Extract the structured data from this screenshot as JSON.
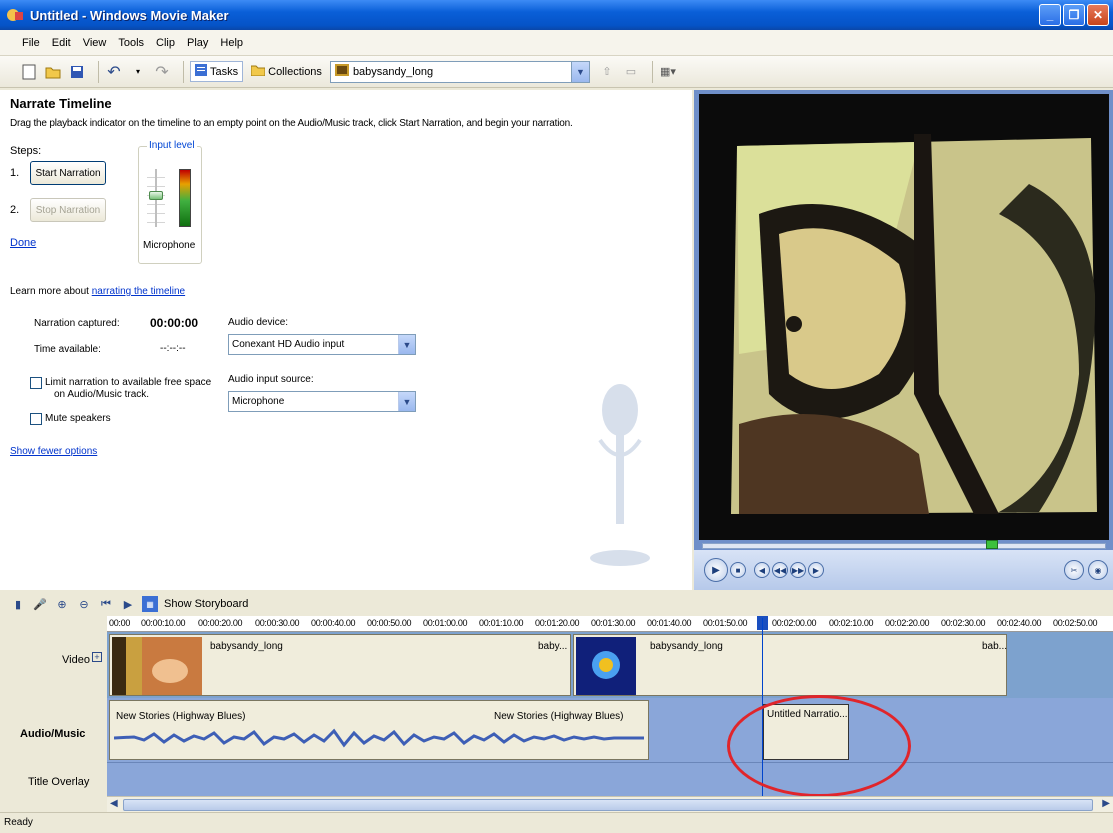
{
  "window": {
    "title": "Untitled - Windows Movie Maker"
  },
  "menu": [
    "File",
    "Edit",
    "View",
    "Tools",
    "Clip",
    "Play",
    "Help"
  ],
  "toolbar": {
    "tasks_label": "Tasks",
    "collections_label": "Collections",
    "collection_value": "babysandy_long"
  },
  "narrate": {
    "title": "Narrate Timeline",
    "instructions": "Drag the playback indicator on the timeline to an empty point on the Audio/Music track, click Start Narration, and begin your narration.",
    "steps_label": "Steps:",
    "step1_num": "1.",
    "step2_num": "2.",
    "start_label": "Start Narration",
    "stop_label": "Stop Narration",
    "done_label": "Done",
    "input_level_label": "Input level",
    "microphone_label": "Microphone",
    "input_level_value": 0.55,
    "learn_prefix": "Learn more about ",
    "learn_link": "narrating the timeline",
    "captured_label": "Narration captured:",
    "captured_value": "00:00:00",
    "available_label": "Time available:",
    "available_value": "--:--:--",
    "audio_device_label": "Audio device:",
    "audio_device_value": "Conexant HD Audio input",
    "audio_source_label": "Audio input source:",
    "audio_source_value": "Microphone",
    "limit_label_1": "Limit narration to available free space",
    "limit_label_2": "on Audio/Music track.",
    "mute_label": "Mute speakers",
    "fewer_label": "Show fewer options"
  },
  "timeline": {
    "storyboard_label": "Show Storyboard",
    "ruler": [
      "00:00",
      "00:00:10.00",
      "00:00:20.00",
      "00:00:30.00",
      "00:00:40.00",
      "00:00:50.00",
      "00:01:00.00",
      "00:01:10.00",
      "00:01:20.00",
      "00:01:30.00",
      "00:01:40.00",
      "00:01:50.00",
      "00:02:00.00",
      "00:02:10.00",
      "00:02:20.00",
      "00:02:30.00",
      "00:02:40.00",
      "00:02:50.00"
    ],
    "tracks": {
      "video": "Video",
      "audio": "Audio/Music",
      "title": "Title Overlay"
    },
    "video_clips": [
      "babysandy_long",
      "baby...",
      "babysandy_long",
      "bab..."
    ],
    "audio_clips": [
      "New Stories (Highway Blues)",
      "New Stories (Highway Blues)",
      "Untitled Narratio..."
    ]
  },
  "status": {
    "text": "Ready"
  }
}
